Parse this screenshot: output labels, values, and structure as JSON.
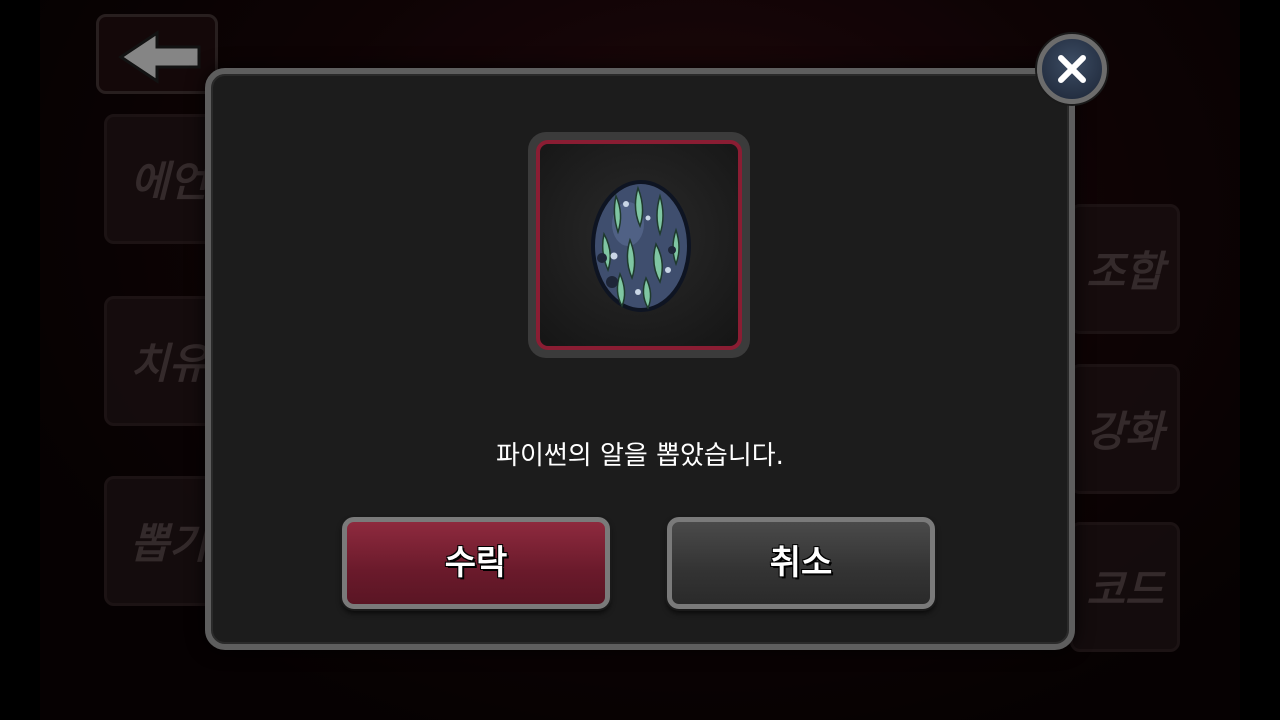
{
  "background": {
    "side_menu_left": [
      "에언",
      "치유",
      "뽑기"
    ],
    "side_menu_right": [
      "조합",
      "강화",
      "코드"
    ]
  },
  "dialog": {
    "item_icon": "python-egg-icon",
    "message": "파이썬의 알을 뽑았습니다.",
    "accept_label": "수락",
    "cancel_label": "취소"
  },
  "colors": {
    "accept": "#7a1f33",
    "cancel": "#3a3a3a",
    "item_border": "#8a1d33",
    "close_button": "#2b3850"
  }
}
